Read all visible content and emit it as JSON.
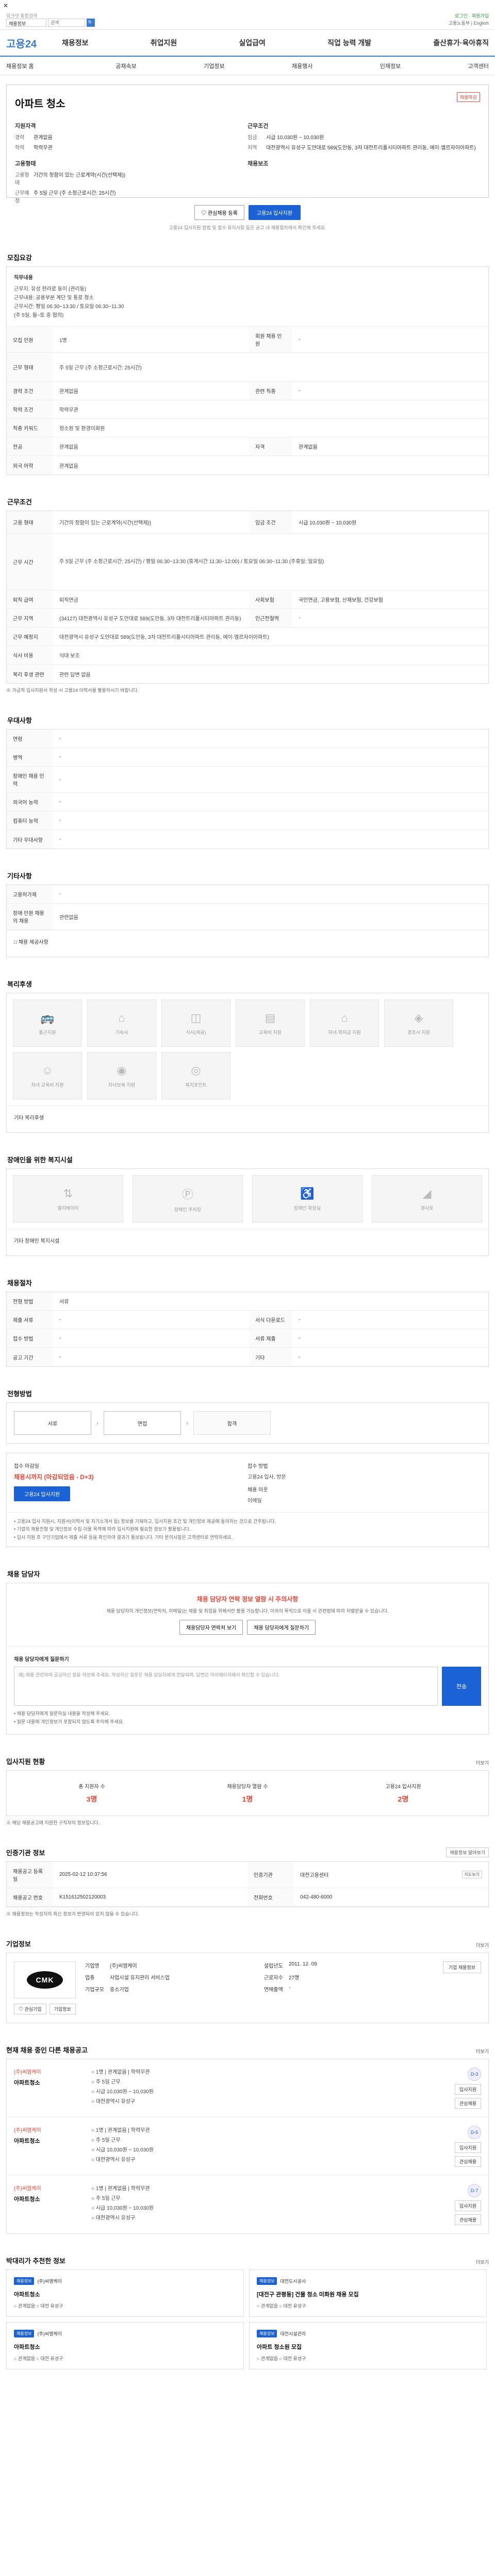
{
  "topbar": {
    "close": "✕",
    "search_title": "워크넷 통합검색",
    "search_select": "채용정보",
    "search_placeholder": "검색",
    "search_btn": "🔍",
    "login": "로그인 · 회원가입",
    "util": "고용노동부  |  English"
  },
  "gnb": {
    "logo_a": "고용",
    "logo_b": "24",
    "menu": [
      "채용정보",
      "취업지원",
      "실업급여",
      "직업 능력 개발",
      "출산휴가·육아휴직"
    ]
  },
  "lnb": [
    "채용정보 홈",
    "공채속보",
    "기업정보",
    "채용행사",
    "인재정보",
    "고객센터"
  ],
  "job": {
    "tag": "채용마감",
    "title": "아파트 청소",
    "left_heading": "지원자격",
    "left": [
      {
        "k": "경력",
        "v": "관계없음"
      },
      {
        "k": "학력",
        "v": "학력무관"
      }
    ],
    "left_heading2": "고용형태",
    "left2": [
      {
        "k": "고용형태",
        "v": "기간의 정함이 있는 근로계약(시간(선택제))"
      },
      {
        "k": "근무예정",
        "v": "주 5일 근무 (주 소정근로시간: 25시간)"
      }
    ],
    "right_heading": "근무조건",
    "right": [
      {
        "k": "임금",
        "v": "시급 10,030원 ~ 10,030원"
      },
      {
        "k": "지역",
        "v": "대전광역시 유성구 도안대로 589(도안동, 3차 대전트리풀시티아파트 관리동, 에이·엘르자이아파트)"
      }
    ],
    "right_heading2": "채용보조",
    "btn_scrap": "♡  관심채용 등록",
    "btn_apply": "고용24 입사지원",
    "notice": "고용24 입사지원 방법 및 접수 유의사항 등은 공고 내 채용절차에서 확인해 주세요."
  },
  "sec_job": {
    "title": "모집요강",
    "intro_label": "직무내용",
    "intro": [
      "근무지: 유성 한라로 동이 (관리동)",
      "근무내용: 공용부분 계단 및 통로 청소",
      "근무시간: 평일 06:30~13:30 / 토요일 06:30~11:30",
      "(주 5일, 월~토 중 협의)"
    ],
    "rows": [
      {
        "l": "모집 인원",
        "v": "1명",
        "l2": "회원 채용 인원",
        "v2": "-"
      },
      {
        "l": "근무 형태",
        "v": "주 5일 근무 (주 소정근로시간: 25시간)",
        "l2": "",
        "v2": ""
      },
      {
        "l": "경력 조건",
        "v": "관계없음",
        "l2": "관련 직종",
        "v2": "-"
      },
      {
        "l": "학력 조건",
        "v": "학력무관",
        "l2": "",
        "v2": ""
      },
      {
        "l": "직종 키워드",
        "v": "청소원 및 환경미화원",
        "l2": "",
        "v2": ""
      },
      {
        "l": "전공",
        "v": "관계없음",
        "l2": "자격",
        "v2": "관계없음"
      },
      {
        "l": "외국 어학",
        "v": "관계없음",
        "l2": "",
        "v2": ""
      }
    ]
  },
  "sec_cond": {
    "title": "근무조건",
    "rows": [
      {
        "l": "고용 형태",
        "v": "기간의 정함이 있는 근로계약(시간(선택제))",
        "l2": "임금 조건",
        "v2": "시급 10,030원 ~ 10,030원"
      },
      {
        "l": "근무 시간",
        "v": "주 5일 근무 (주 소정근로시간: 25시간) / 평일 06:30~13:30 (휴게시간 11:30~12:00) / 토요일 06:30~11:30 (주휴일: 일요일)",
        "l2": "",
        "v2": ""
      },
      {
        "l": "퇴직 급여",
        "v": "퇴직연금",
        "l2": "사회보험",
        "v2": "국민연금, 고용보험, 산재보험, 건강보험"
      },
      {
        "l": "근무 지역",
        "v": "(34127) 대전광역시 유성구 도안대로 589(도안동, 3차 대전트리풀시티아파트 관리동)",
        "l2": "인근전철역",
        "v2": "-"
      },
      {
        "l": "근무 예정지",
        "v": "대전광역시 유성구 도안대로 589(도안동, 3차 대전트리풀시티아파트 관리동, 에이·엘르자이아파트)",
        "l2": "",
        "v2": ""
      },
      {
        "l": "식사 비용",
        "v": "식대 보조",
        "l2": "",
        "v2": ""
      },
      {
        "l": "복리 후생 관련",
        "v": "관련 답변 없음",
        "l2": "",
        "v2": ""
      }
    ],
    "foot": "※ 가급적 입사지원서 작성 시 고용24 이력서를 활용하시기 바랍니다."
  },
  "sec_pref": {
    "title": "우대사항",
    "rows": [
      {
        "l": "연령",
        "v": "-"
      },
      {
        "l": "병역",
        "v": "-"
      },
      {
        "l": "장애인 채용 인력",
        "v": "-"
      },
      {
        "l": "외국어 능력",
        "v": "-"
      },
      {
        "l": "컴퓨터 능력",
        "v": "-"
      },
      {
        "l": "기타 우대사항",
        "v": "-"
      }
    ]
  },
  "sec_etc": {
    "title": "기타사항",
    "rows": [
      {
        "l": "고용허가제",
        "v": "-"
      },
      {
        "l": "장애 인원 채용의 채용",
        "v": "관련없음"
      }
    ],
    "foot": "□ 채용 제공사항"
  },
  "sec_welfare": {
    "title": "복리후생",
    "tiles": [
      "통근지원",
      "기숙사",
      "식사(제공)",
      "교육비 지원",
      "자녀·학자금 지원",
      "경조사 지원",
      "자녀 교육비 지원",
      "자녀보육 지원",
      "복지포인트"
    ],
    "foot": "기타 복리후생"
  },
  "sec_disable": {
    "title": "장애인을 위한 복지시설",
    "tiles": [
      "엘리베이터",
      "장애인 주차장",
      "장애인 화장실",
      "경사로"
    ],
    "foot": "기타 장애인 복지시설"
  },
  "sec_proc": {
    "title": "채용절차",
    "rows": [
      {
        "l": "전형 방법",
        "v": "서류",
        "l2": "",
        "v2": ""
      },
      {
        "l": "제출 서류",
        "v": "-",
        "l2": "서식 다운로드",
        "v2": "-"
      },
      {
        "l": "접수 방법",
        "v": "-",
        "l2": "서류 제출",
        "v2": "-"
      },
      {
        "l": "공고 기간",
        "v": "-",
        "l2": "기타",
        "v2": "-"
      }
    ]
  },
  "sec_stage": {
    "title": "전형방법",
    "stages": [
      "서류",
      "면접",
      "합격"
    ],
    "arrow": "›"
  },
  "sec_apply": {
    "deadline_label": "접수 마감일",
    "deadline": "채용시까지 (마감되었음 - D+3)",
    "btn": "고용24 입사지원",
    "method_label": "접수 방법",
    "method": "고용24 입사, 방문",
    "contact_label": "채용 이웃",
    "contact": "이메일",
    "note": [
      "• 고용24 입사 지원시, 지원서(이력서 및 자기소개서 등) 정보를 기재하고, 입사지원 조건 및 개인정보 제공에 동의하는 것으로 간주됩니다.",
      "• 기업의 채용전형 및 개인정보 수집·이용 목적에 따라 입사지원에 필요한 정보가 활용됩니다.",
      "• 입사 지원 후 구인기업에서 제출 서류 등을 확인하여 결과가 통보됩니다. 기타 문의사항은 고객센터로 연락하세요."
    ]
  },
  "sec_qa": {
    "title": "채용 담당자",
    "head": "채용 담당자 연락 정보 열람 시 주의사항",
    "desc": "채용 담당자의 개인정보(연락처, 이메일)는 채용 및 취업을 위해서만 활용 가능합니다. 이외의 목적으로 이용 시 관련법에 따라 처벌받을 수 있습니다.",
    "btn1": "채용담당자 연락처 보기",
    "btn2": "채용 담당자에게 질문하기",
    "form_label": "채용 담당자에게 질문하기",
    "form_placeholder": "예) 채용 관련하여 궁금하신 점을 작성해 주세요. 작성하신 질문은 채용 담당자에게 전달되며, 답변은 마이페이지에서 확인할 수 있습니다.",
    "form_send": "전송",
    "hint1": "• 채용 담당자에게 질문하실 내용을 작성해 주세요.",
    "hint2": "• 질문 내용에 개인정보가 포함되지 않도록 주의해 주세요."
  },
  "sec_stat": {
    "title": "입사지원 현황",
    "more": "더보기",
    "items": [
      {
        "lb": "총 지원자 수",
        "v": "3명"
      },
      {
        "lb": "채용담당자 열람 수",
        "v": "1명"
      },
      {
        "lb": "고용24 입사지원",
        "v": "2명"
      }
    ],
    "note": "※ 해당 채용공고에 지원한 구직자의 정보입니다."
  },
  "sec_info": {
    "title": "인증기관 정보",
    "more": "채용정보 알아보기",
    "cells": [
      {
        "l": "채용공고 등록일",
        "v": "2025-02-12 10:37:56"
      },
      {
        "l": "인증기관",
        "v": "대전고용센터"
      },
      {
        "l": "채용공고 번호",
        "v": "K151612502120003"
      },
      {
        "l": "전화번호",
        "v": "042-480-6000"
      }
    ],
    "mini": "지도보기",
    "foot": "※ 채용정보는 작성자의 최신 정보가 반영되어 있지 않을 수 있습니다."
  },
  "sec_company": {
    "title": "기업정보",
    "more": "더보기",
    "logo": "CMK",
    "kv": [
      {
        "k": "기업명",
        "v": "(주)씨엠케이"
      },
      {
        "k": "업종",
        "v": "사업시설 유지관리 서비스업"
      },
      {
        "k": "기업규모",
        "v": "중소기업"
      },
      {
        "k": "설립년도",
        "v": "2011. 12. 09"
      },
      {
        "k": "근로자수",
        "v": "27명"
      },
      {
        "k": "연매출액",
        "v": "-"
      }
    ],
    "btn_left": [
      "♡ 관심기업",
      "기업정보"
    ],
    "btn_right": "기업 채용정보"
  },
  "sec_list": {
    "title": "현재 채용 중인 다른 채용공고",
    "more": "더보기",
    "items": [
      {
        "org": "(주)씨엠케이",
        "nm": "아파트청소",
        "d": [
          "○ 1명  |  관계없음  |  학력무관",
          "○ 주 5일 근무",
          "○ 시급 10,030원 ~ 10,030원",
          "○ 대전광역시 유성구"
        ],
        "badge": "D-3",
        "bt": [
          "입사지원",
          "관심채용"
        ]
      },
      {
        "org": "(주)씨엠케이",
        "nm": "아파트청소",
        "d": [
          "○ 1명  |  관계없음  |  학력무관",
          "○ 주 5일 근무",
          "○ 시급 10,030원 ~ 10,030원",
          "○ 대전광역시 유성구"
        ],
        "badge": "D-5",
        "bt": [
          "입사지원",
          "관심채용"
        ]
      },
      {
        "org": "(주)씨엠케이",
        "nm": "아파트청소",
        "d": [
          "○ 1명  |  관계없음  |  학력무관",
          "○ 주 5일 근무",
          "○ 시급 10,030원 ~ 10,030원",
          "○ 대전광역시 유성구"
        ],
        "badge": "D-7",
        "bt": [
          "입사지원",
          "관심채용"
        ]
      }
    ]
  },
  "sec_rec": {
    "title": "박대리가 추천한 정보",
    "more": "더보기",
    "items": [
      {
        "tg": "채용정보",
        "org": "(주)씨엠케이",
        "nm": "아파트청소",
        "ex": "○ 관계없음   ○ 대전 유성구"
      },
      {
        "tg": "채용정보",
        "org": "대전도시공사",
        "nm": "[대전구 관평동] 건물 청소 미화원 채용 모집",
        "ex": "○ 관계없음   ○ 대전 유성구"
      },
      {
        "tg": "채용정보",
        "org": "(주)씨엠케이",
        "nm": "아파트청소",
        "ex": "○ 관계없음   ○ 대전 유성구"
      },
      {
        "tg": "채용정보",
        "org": "대전시설관리",
        "nm": "아파트 청소원 모집",
        "ex": "○ 관계없음   ○ 대전 유성구"
      }
    ]
  }
}
